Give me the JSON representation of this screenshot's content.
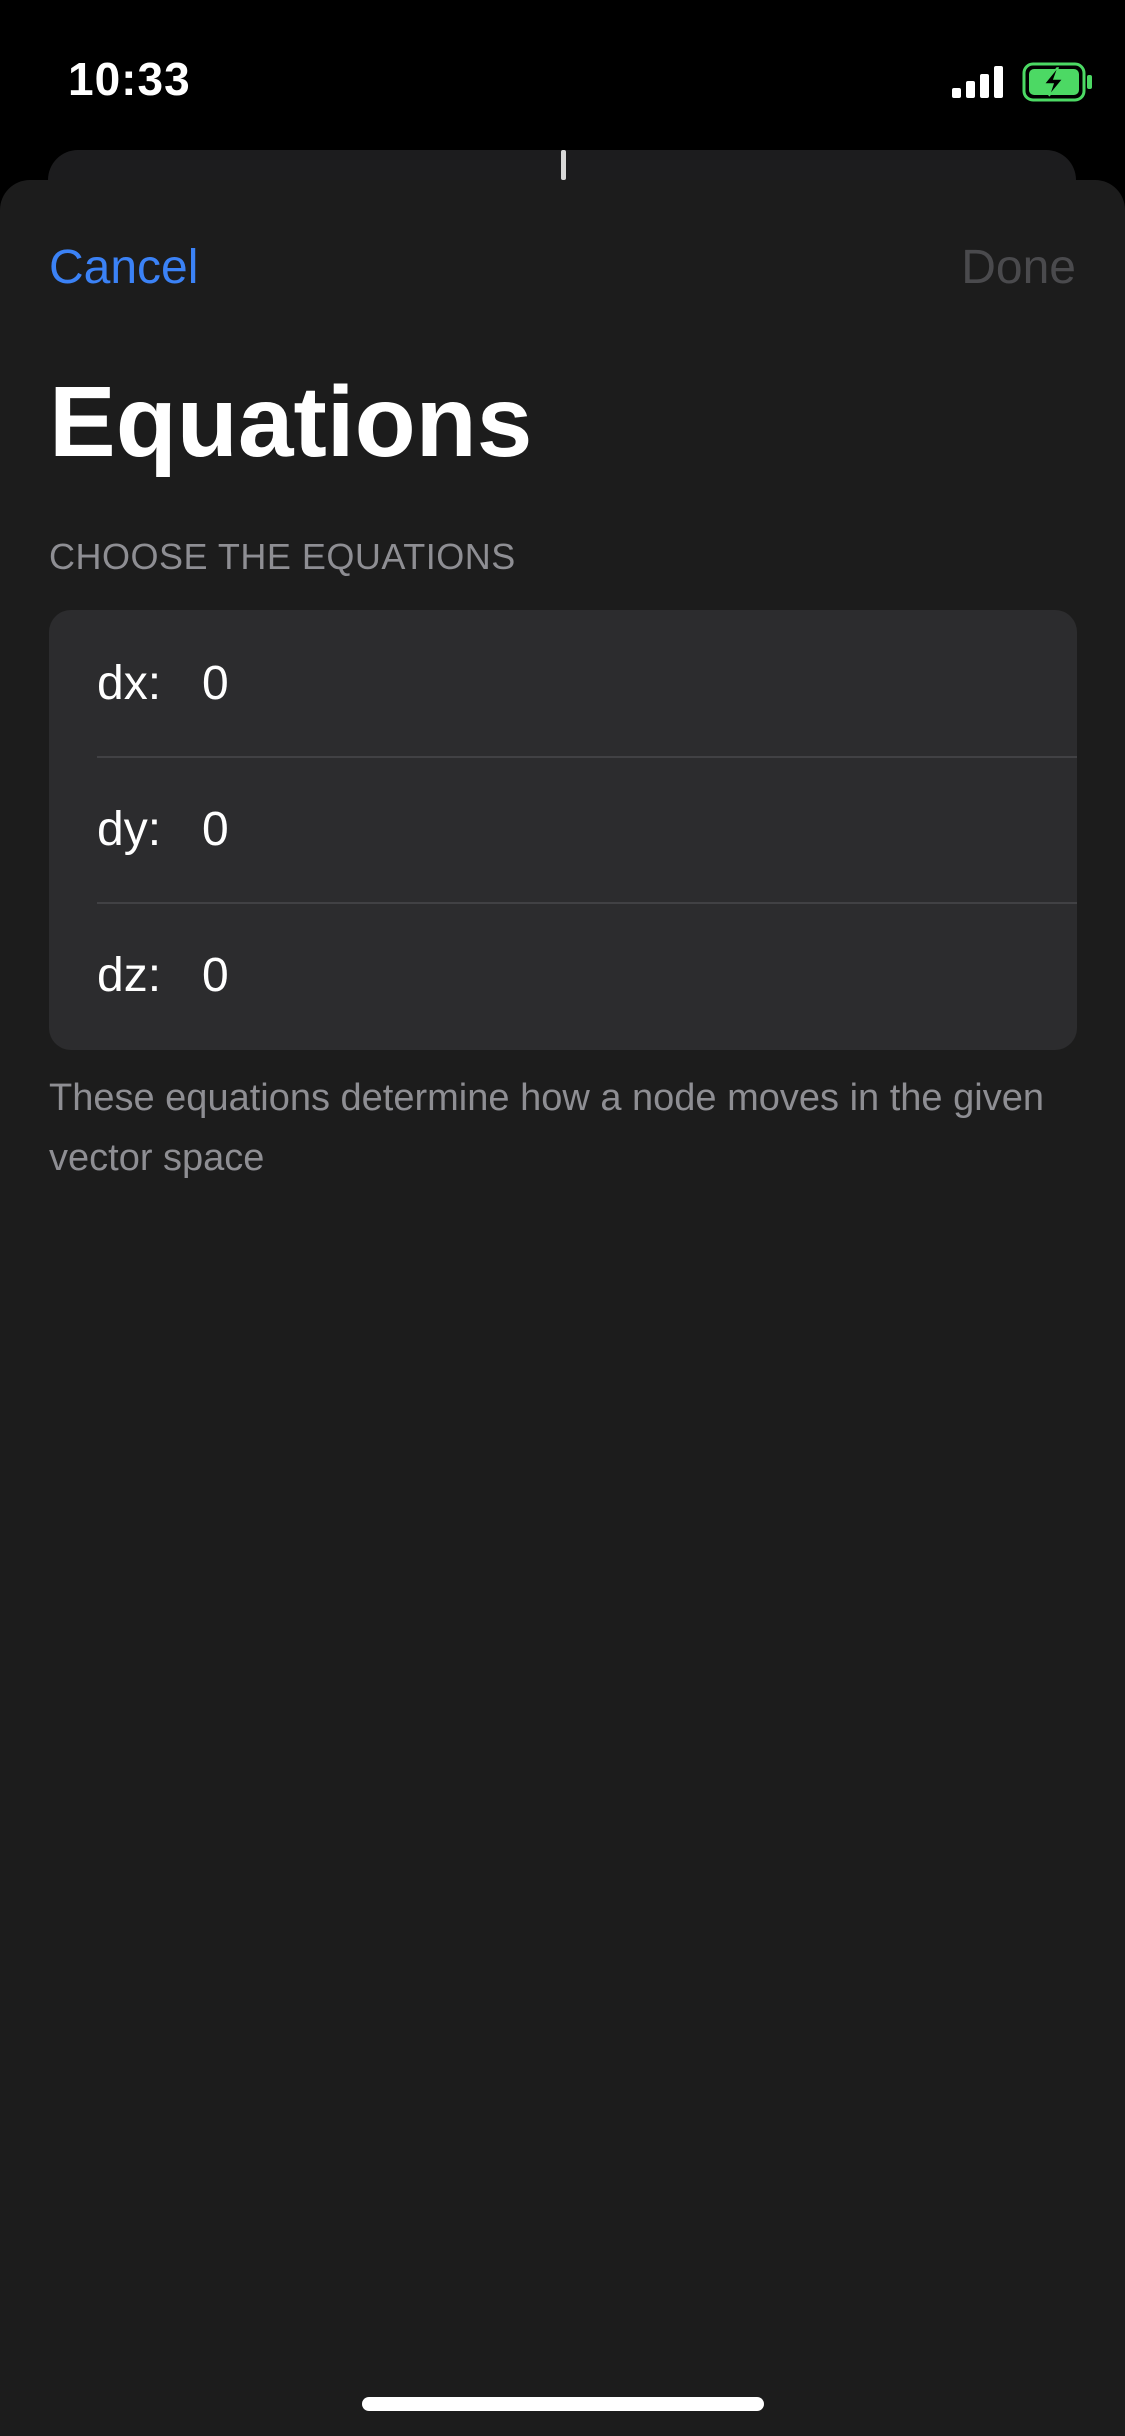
{
  "status_bar": {
    "time": "10:33",
    "signal_icon": "cellular-signal-icon",
    "battery_icon": "battery-charging-icon",
    "battery_color": "#4cd964"
  },
  "nav": {
    "cancel_label": "Cancel",
    "done_label": "Done"
  },
  "colors": {
    "accent": "#3b82f6",
    "sheet_background": "#1c1c1c",
    "group_background": "#2c2c2e",
    "secondary_text": "#8e8e93",
    "disabled_text": "#4a4a4d"
  },
  "page": {
    "title": "Equations"
  },
  "equations": {
    "section_header": "CHOOSE THE EQUATIONS",
    "rows": [
      {
        "label": "dx:",
        "value": "0"
      },
      {
        "label": "dy:",
        "value": "0"
      },
      {
        "label": "dz:",
        "value": "0"
      }
    ],
    "footer": "These equations determine how a node moves in the given vector space"
  }
}
